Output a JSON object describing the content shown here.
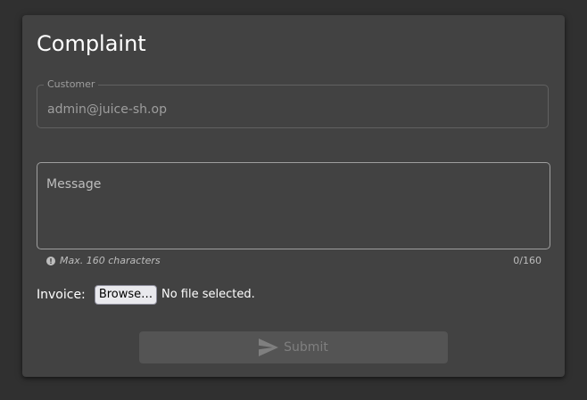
{
  "page": {
    "title": "Complaint"
  },
  "customer": {
    "label": "Customer",
    "value": "admin@juice-sh.op"
  },
  "message": {
    "placeholder": "Message",
    "value": "",
    "hint": "Max. 160 characters",
    "counter": "0/160"
  },
  "invoice": {
    "label": "Invoice:",
    "browse_label": "Browse…",
    "file_status": "No file selected."
  },
  "submit": {
    "label": "Submit",
    "icon": "send-icon",
    "enabled": false
  },
  "colors": {
    "background": "#303030",
    "card": "#424242",
    "text": "#ffffff",
    "muted": "#9e9e9e"
  }
}
